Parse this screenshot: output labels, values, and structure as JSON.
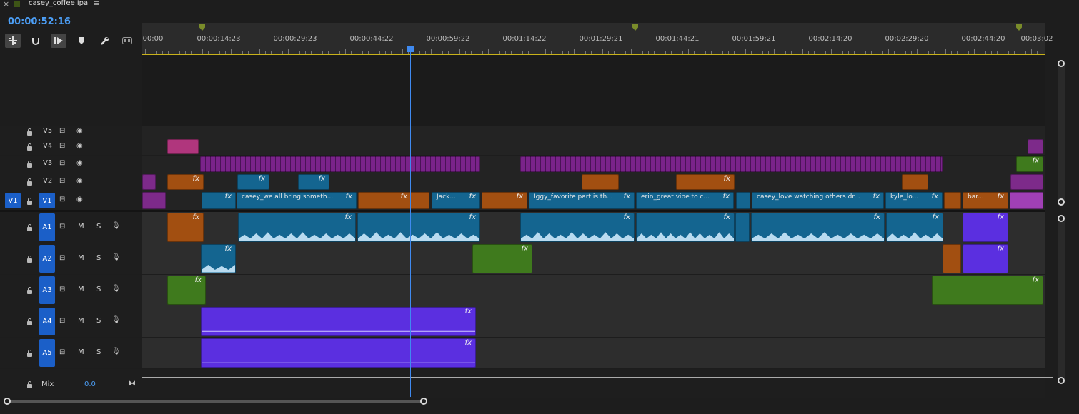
{
  "tab": {
    "close_glyph": "×",
    "title": "casey_coffee ipa",
    "menu_glyph": "≡",
    "color": "#3d5416"
  },
  "timecode": "00:00:52:16",
  "toolbar": {
    "insert_icon": "insert-overwrite-icon",
    "snap_icon": "snap-magnet-icon",
    "linked_icon": "linked-selection-icon",
    "marker_icon": "add-marker-icon",
    "settings_icon": "wrench-icon",
    "captions_icon": "captions-icon"
  },
  "ruler": {
    "labels": [
      "00:00",
      "00:00:14:23",
      "00:00:29:23",
      "00:00:44:22",
      "00:00:59:22",
      "00:01:14:22",
      "00:01:29:21",
      "00:01:44:21",
      "00:01:59:21",
      "00:02:14:20",
      "00:02:29:20",
      "00:02:44:20",
      "00:03:02"
    ]
  },
  "video_tracks": [
    {
      "name": "V5",
      "patch": ""
    },
    {
      "name": "V4",
      "patch": ""
    },
    {
      "name": "V3",
      "patch": ""
    },
    {
      "name": "V2",
      "patch": ""
    },
    {
      "name": "V1",
      "patch": "V1"
    }
  ],
  "audio_tracks": [
    {
      "name": "A1",
      "m": "M",
      "s": "S"
    },
    {
      "name": "A2",
      "m": "M",
      "s": "S"
    },
    {
      "name": "A3",
      "m": "M",
      "s": "S"
    },
    {
      "name": "A4",
      "m": "M",
      "s": "S"
    },
    {
      "name": "A5",
      "m": "M",
      "s": "S"
    }
  ],
  "mix": {
    "label": "Mix",
    "value": "0.0"
  },
  "clip_labels": {
    "c1": "casey_we all bring someth...",
    "c2": "Jack...",
    "c3": "Iggy_favorite part is th...",
    "c4": "erin_great vibe to c...",
    "c5": "casey_love watching others dr...",
    "c6": "kyle_lo...",
    "c7": "bar..."
  },
  "fx_label": "fx",
  "colors": {
    "accent": "#3f8af0",
    "teal": "#146590",
    "orange": "#a24f11",
    "green": "#3f7a1d",
    "violet": "#5b2fe0",
    "magenta": "#7a238a"
  }
}
